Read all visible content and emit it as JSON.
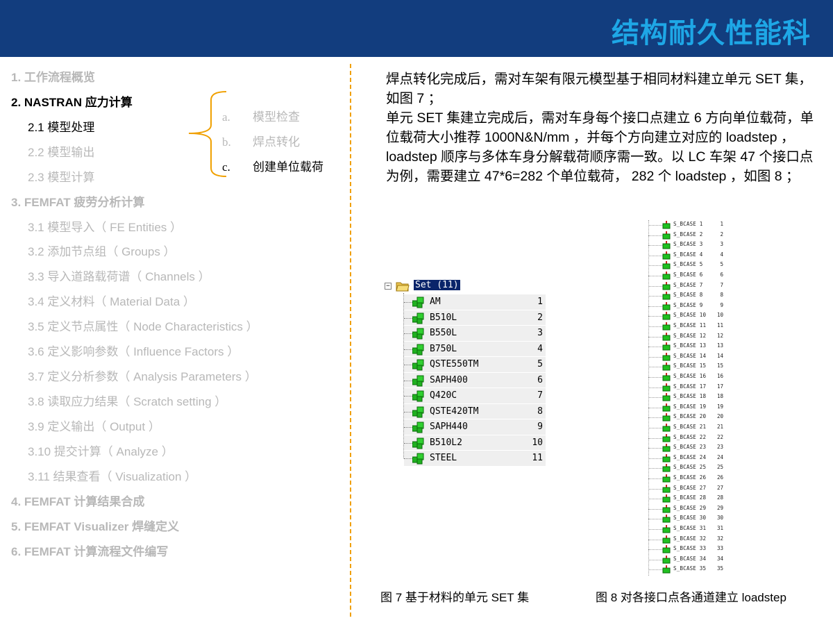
{
  "header": {
    "title": "结构耐久性能科",
    "background": "#123d7e",
    "title_color": "#1ea7e6"
  },
  "toc": [
    {
      "label": "1.  工作流程概览",
      "level": 1,
      "active": false
    },
    {
      "label": "2. NASTRAN 应力计算",
      "level": 1,
      "active": true
    },
    {
      "label": "2.1  模型处理",
      "level": 2,
      "active": true
    },
    {
      "label": "2.2  模型输出",
      "level": 2,
      "active": false
    },
    {
      "label": "2.3  模型计算",
      "level": 2,
      "active": false
    },
    {
      "label": "3. FEMFAT 疲劳分析计算",
      "level": 1,
      "active": false
    },
    {
      "label": "3.1  模型导入（ FE Entities ）",
      "level": 2,
      "active": false
    },
    {
      "label": "3.2  添加节点组（ Groups ）",
      "level": 2,
      "active": false
    },
    {
      "label": "3.3  导入道路载荷谱（ Channels ）",
      "level": 2,
      "active": false
    },
    {
      "label": "3.4  定义材料（ Material Data ）",
      "level": 2,
      "active": false
    },
    {
      "label": "3.5  定义节点属性（ Node Characteristics ）",
      "level": 2,
      "active": false
    },
    {
      "label": "3.6  定义影响参数（ Influence Factors ）",
      "level": 2,
      "active": false
    },
    {
      "label": "3.7  定义分析参数（ Analysis Parameters ）",
      "level": 2,
      "active": false
    },
    {
      "label": "3.8  读取应力结果（ Scratch setting ）",
      "level": 2,
      "active": false
    },
    {
      "label": "3.9  定义输出（ Output ）",
      "level": 2,
      "active": false
    },
    {
      "label": "3.10  提交计算（ Analyze ）",
      "level": 2,
      "active": false
    },
    {
      "label": "3.11   结果查看（ Visualization ）",
      "level": 2,
      "active": false
    },
    {
      "label": "4. FEMFAT 计算结果合成",
      "level": 1,
      "active": false
    },
    {
      "label": "5. FEMFAT Visualizer  焊缝定义",
      "level": 1,
      "active": false
    },
    {
      "label": "6. FEMFAT 计算流程文件编写",
      "level": 1,
      "active": false
    }
  ],
  "sub_items": [
    {
      "letter": "a.",
      "label": "模型检查",
      "active": false
    },
    {
      "letter": "b.",
      "label": "焊点转化",
      "active": false
    },
    {
      "letter": "c.",
      "label": "创建单位载荷",
      "active": true
    }
  ],
  "paragraph": [
    "焊点转化完成后，需对车架有限元模型基于相同材料建立单元 SET 集，如图 7 ；",
    "单元 SET 集建立完成后，需对车身每个接口点建立 6 方向单位载荷，单位载荷大小推荐 1000N&N/mm ，并每个方向建立对应的 loadstep ，   loadstep 顺序与多体车身分解载荷顺序需一致。以 LC 车架 47 个接口点为例，需要建立 47*6=282 个单位载荷， 282 个 loadstep ，如图 8 ；"
  ],
  "figure7": {
    "root_label": "Set (11)",
    "items": [
      {
        "name": "AM",
        "id": "1"
      },
      {
        "name": "B510L",
        "id": "2"
      },
      {
        "name": "B550L",
        "id": "3"
      },
      {
        "name": "B750L",
        "id": "4"
      },
      {
        "name": "QSTE550TM",
        "id": "5"
      },
      {
        "name": "SAPH400",
        "id": "6"
      },
      {
        "name": "Q420C",
        "id": "7"
      },
      {
        "name": "QSTE420TM",
        "id": "8"
      },
      {
        "name": "SAPH440",
        "id": "9"
      },
      {
        "name": "B510L2",
        "id": "10"
      },
      {
        "name": "STEEL",
        "id": "11"
      }
    ],
    "caption": "图 7  基于材料的单元 SET 集"
  },
  "figure8": {
    "items": [
      {
        "name": "S_BCASE 1",
        "id": "1"
      },
      {
        "name": "S_BCASE 2",
        "id": "2"
      },
      {
        "name": "S_BCASE 3",
        "id": "3"
      },
      {
        "name": "S_BCASE 4",
        "id": "4"
      },
      {
        "name": "S_BCASE 5",
        "id": "5"
      },
      {
        "name": "S_BCASE 6",
        "id": "6"
      },
      {
        "name": "S_BCASE 7",
        "id": "7"
      },
      {
        "name": "S_BCASE 8",
        "id": "8"
      },
      {
        "name": "S_BCASE 9",
        "id": "9"
      },
      {
        "name": "S_BCASE 10",
        "id": "10"
      },
      {
        "name": "S_BCASE 11",
        "id": "11"
      },
      {
        "name": "S_BCASE 12",
        "id": "12"
      },
      {
        "name": "S_BCASE 13",
        "id": "13"
      },
      {
        "name": "S_BCASE 14",
        "id": "14"
      },
      {
        "name": "S_BCASE 15",
        "id": "15"
      },
      {
        "name": "S_BCASE 16",
        "id": "16"
      },
      {
        "name": "S_BCASE 17",
        "id": "17"
      },
      {
        "name": "S_BCASE 18",
        "id": "18"
      },
      {
        "name": "S_BCASE 19",
        "id": "19"
      },
      {
        "name": "S_BCASE 20",
        "id": "20"
      },
      {
        "name": "S_BCASE 21",
        "id": "21"
      },
      {
        "name": "S_BCASE 22",
        "id": "22"
      },
      {
        "name": "S_BCASE 23",
        "id": "23"
      },
      {
        "name": "S_BCASE 24",
        "id": "24"
      },
      {
        "name": "S_BCASE 25",
        "id": "25"
      },
      {
        "name": "S_BCASE 26",
        "id": "26"
      },
      {
        "name": "S_BCASE 27",
        "id": "27"
      },
      {
        "name": "S_BCASE 28",
        "id": "28"
      },
      {
        "name": "S_BCASE 29",
        "id": "29"
      },
      {
        "name": "S_BCASE 30",
        "id": "30"
      },
      {
        "name": "S_BCASE 31",
        "id": "31"
      },
      {
        "name": "S_BCASE 32",
        "id": "32"
      },
      {
        "name": "S_BCASE 33",
        "id": "33"
      },
      {
        "name": "S_BCASE 34",
        "id": "34"
      },
      {
        "name": "S_BCASE 35",
        "id": "35"
      }
    ],
    "caption": "图 8  对各接口点各通道建立 loadstep"
  },
  "icons": {
    "folder": "folder-icon",
    "set_item": "green-set-icon",
    "loadstep_item": "green-loadstep-icon",
    "expander": "collapse-toggle-icon"
  }
}
